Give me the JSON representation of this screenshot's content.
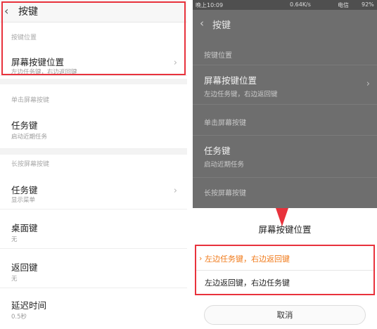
{
  "left": {
    "header": {
      "title": "按键"
    },
    "section_position": "按键位置",
    "screen_key_position": {
      "title": "屏幕按键位置",
      "subtitle": "左边任务键，右边返回键"
    },
    "section_single_tap": "单击屏幕按键",
    "task_key_single": {
      "title": "任务键",
      "subtitle": "启动近期任务"
    },
    "section_long_press": "长按屏幕按键",
    "task_key_long": {
      "title": "任务键",
      "subtitle": "显示菜单"
    },
    "home_key": {
      "title": "桌面键",
      "subtitle": "无"
    },
    "back_key": {
      "title": "返回键",
      "subtitle": "无"
    },
    "delay": {
      "title": "延迟时间",
      "subtitle": "0.5秒"
    }
  },
  "right": {
    "status": {
      "time": "晚上10:09",
      "network": "0.64K/s",
      "carrier": "电信",
      "battery": "92%"
    },
    "header": {
      "title": "按键"
    },
    "section_position": "按键位置",
    "screen_key_position": {
      "title": "屏幕按键位置",
      "subtitle": "左边任务键，右边返回键"
    },
    "section_single_tap": "单击屏幕按键",
    "task_key_single": {
      "title": "任务键",
      "subtitle": "启动近期任务"
    },
    "section_long_press": "长按屏幕按键",
    "dialog": {
      "title": "屏幕按键位置",
      "option_1": "左边任务键，右边返回键",
      "option_2": "左边返回键，右边任务键",
      "cancel": "取消",
      "selected_color": "#f07a1a",
      "normal_color": "#222222"
    }
  },
  "icons": {
    "back": "chevron-left-icon",
    "chevron": "chevron-right-icon",
    "selected": "chevron-right-small-icon"
  },
  "colors": {
    "highlight": "#e8323c",
    "dim_overlay": "#6e6e6e"
  }
}
